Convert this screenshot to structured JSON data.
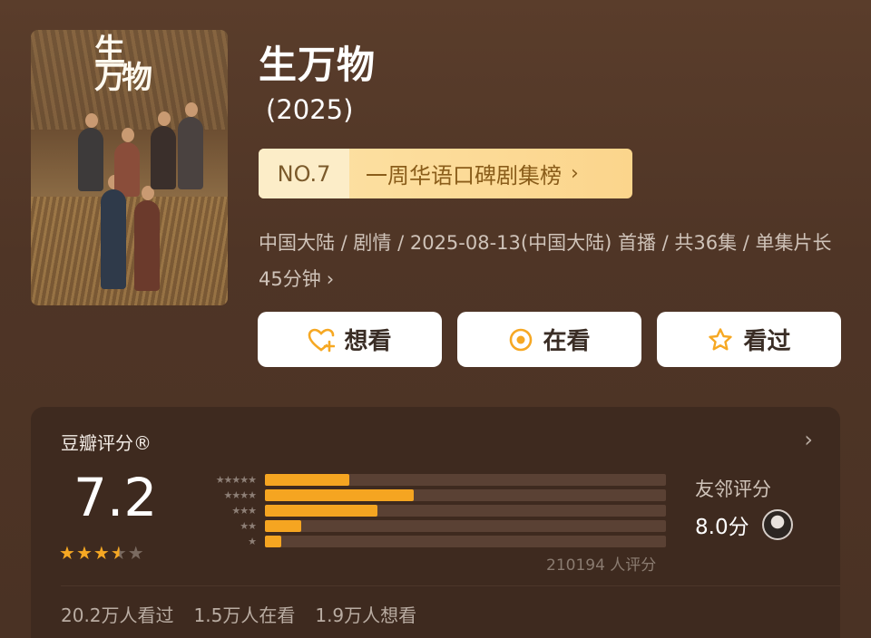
{
  "show": {
    "title": "生万物",
    "year": "(2025)",
    "poster_logo": "生万物"
  },
  "rank": {
    "no": "NO.7",
    "list": "一周华语口碑剧集榜"
  },
  "meta": {
    "info": "中国大陆 / 剧情 / 2025-08-13(中国大陆) 首播 / 共36集 / 单集片长45分钟"
  },
  "actions": {
    "want": "想看",
    "watching": "在看",
    "watched": "看过"
  },
  "rating": {
    "label": "豆瓣评分®",
    "score": "7.2",
    "stars_filled": 3.5,
    "stars_total": 5,
    "distribution": [
      {
        "stars": 5,
        "fraction": 0.21
      },
      {
        "stars": 4,
        "fraction": 0.37
      },
      {
        "stars": 3,
        "fraction": 0.28
      },
      {
        "stars": 2,
        "fraction": 0.09
      },
      {
        "stars": 1,
        "fraction": 0.04
      }
    ],
    "count_text": "210194 人评分",
    "friend_label": "友邻评分",
    "friend_score": "8.0分"
  },
  "stats": {
    "watched": "20.2万人看过",
    "watching": "1.5万人在看",
    "want": "1.9万人想看"
  },
  "colors": {
    "accent": "#f5a521",
    "background": "#4f3526",
    "card": "#3e2a1f"
  }
}
